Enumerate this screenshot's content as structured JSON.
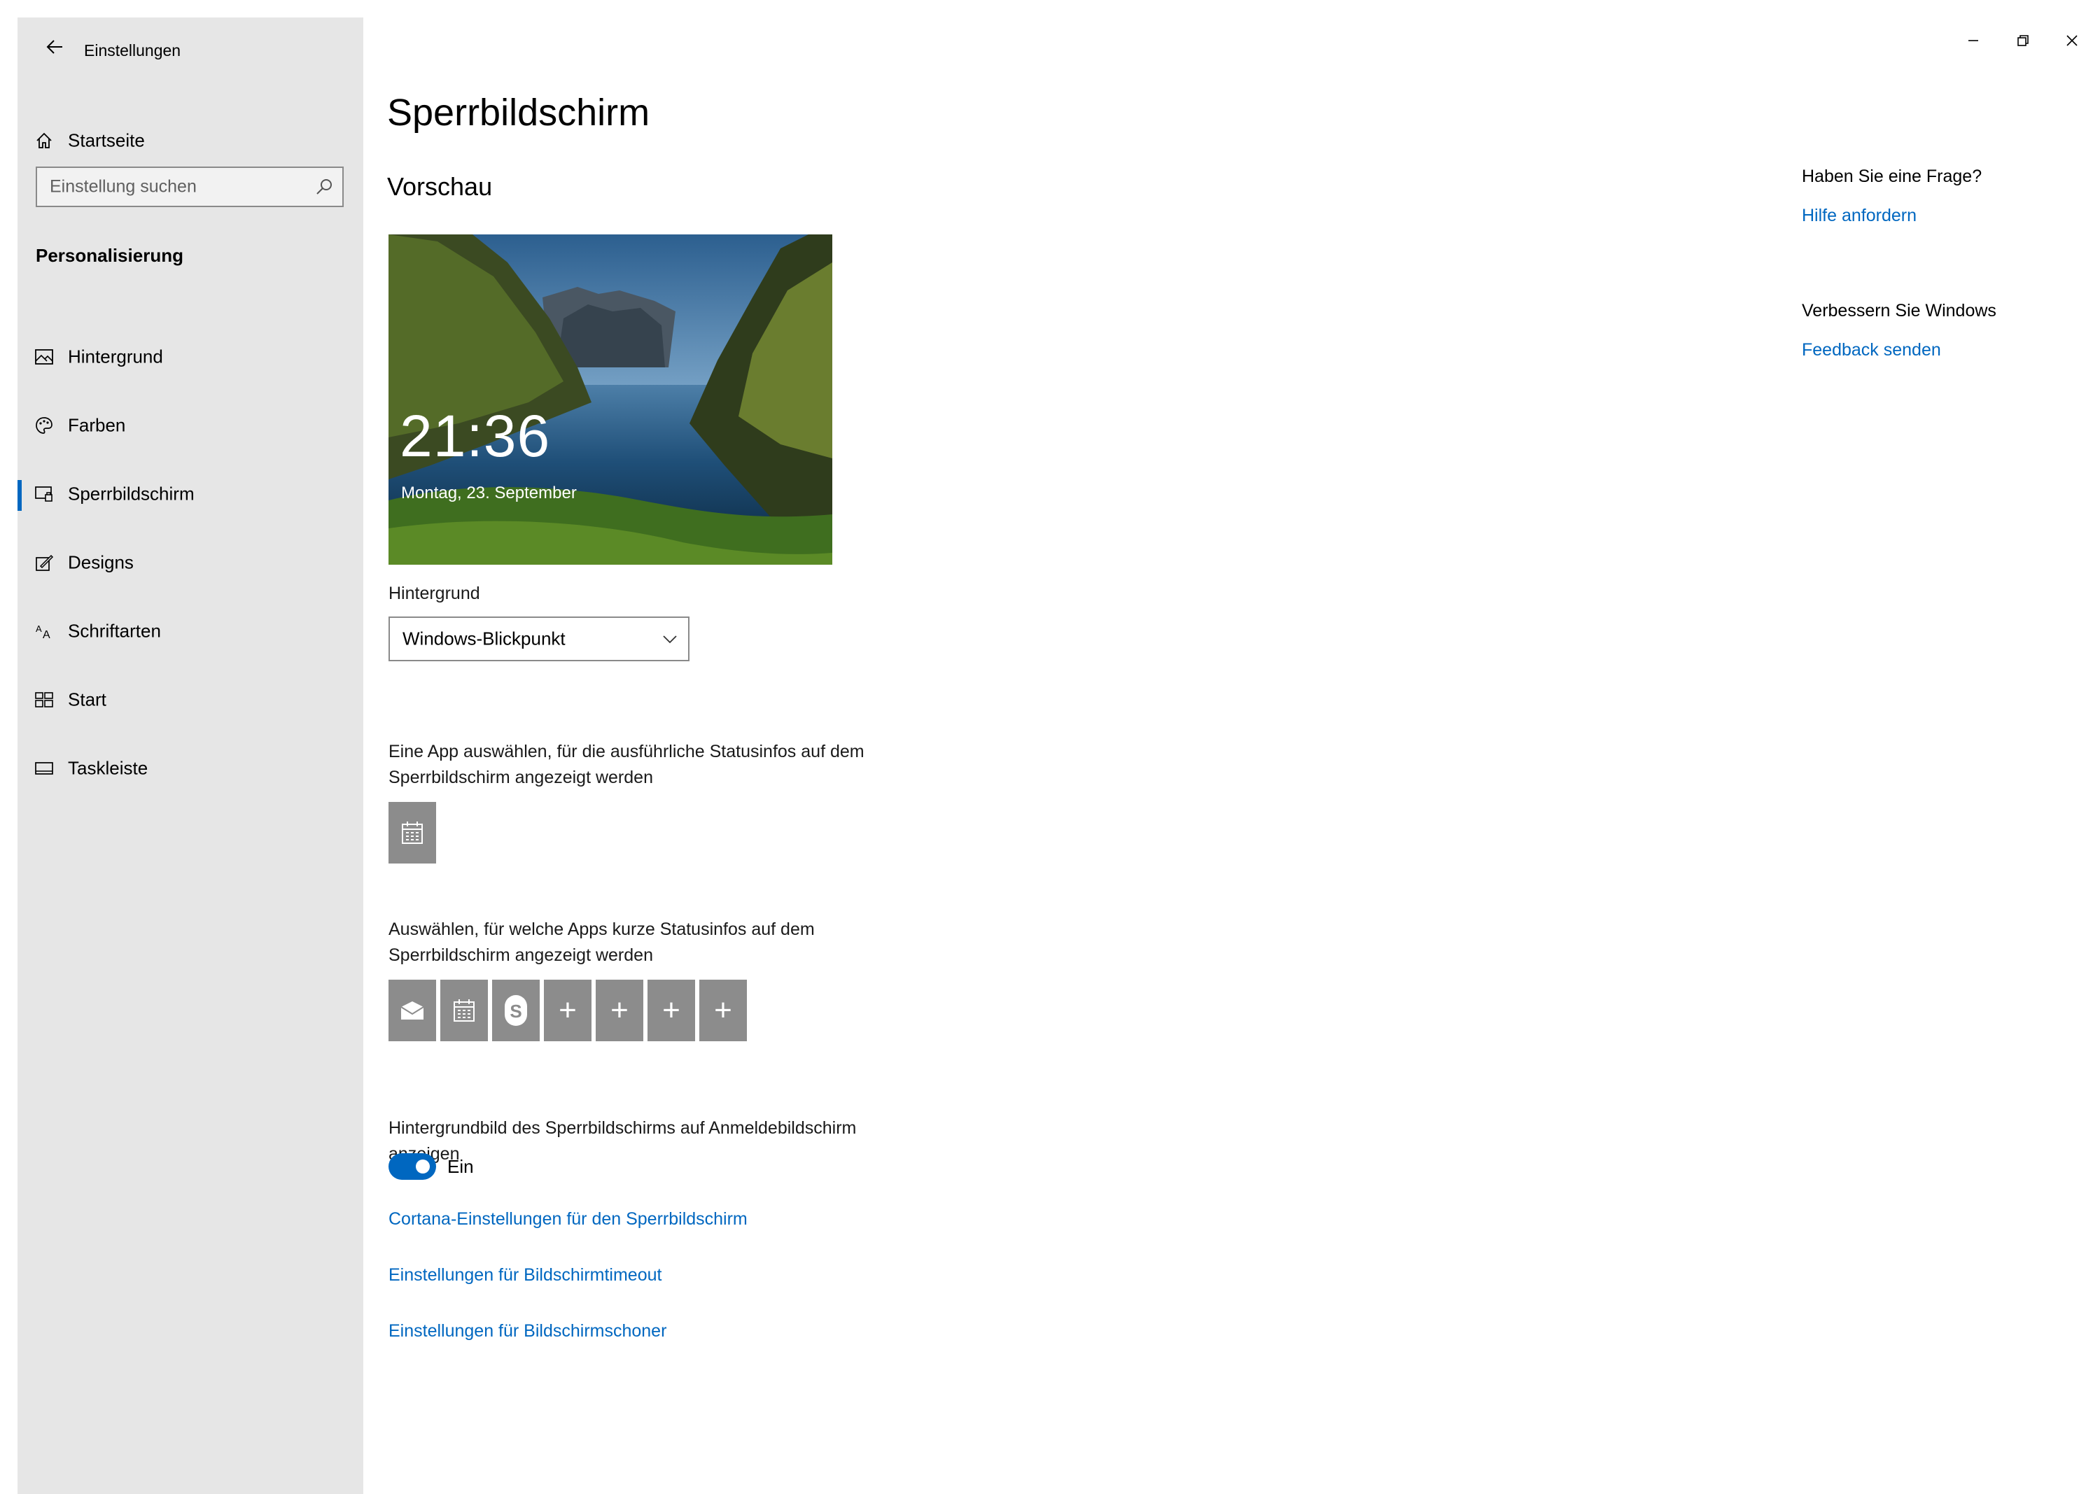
{
  "window": {
    "title": "Einstellungen",
    "controls": {
      "minimize": "minimize-icon",
      "restore": "restore-icon",
      "close": "close-icon"
    }
  },
  "sidebar": {
    "home_label": "Startseite",
    "search_placeholder": "Einstellung suchen",
    "section": "Personalisierung",
    "items": [
      {
        "label": "Hintergrund",
        "icon": "picture-icon"
      },
      {
        "label": "Farben",
        "icon": "palette-icon"
      },
      {
        "label": "Sperrbildschirm",
        "icon": "lockscreen-icon",
        "active": true
      },
      {
        "label": "Designs",
        "icon": "themes-icon"
      },
      {
        "label": "Schriftarten",
        "icon": "fonts-icon"
      },
      {
        "label": "Start",
        "icon": "start-icon"
      },
      {
        "label": "Taskleiste",
        "icon": "taskbar-icon"
      }
    ]
  },
  "main": {
    "title": "Sperrbildschirm",
    "preview_heading": "Vorschau",
    "preview": {
      "time": "21:36",
      "date": "Montag, 23. September"
    },
    "background_label": "Hintergrund",
    "background_value": "Windows-Blickpunkt",
    "detailed_app_text": "Eine App auswählen, für die ausführliche Statusinfos auf dem Sperrbildschirm angezeigt werden",
    "quick_apps_text": "Auswählen, für welche Apps kurze Statusinfos auf dem Sperrbildschirm angezeigt werden",
    "quick_apps": [
      "mail-icon",
      "calendar-icon",
      "skype-icon",
      "+",
      "+",
      "+",
      "+"
    ],
    "signin_bg_text": "Hintergrundbild des Sperrbildschirms auf Anmeldebildschirm anzeigen",
    "toggle_state": "Ein",
    "links": [
      "Cortana-Einstellungen für den Sperrbildschirm",
      "Einstellungen für Bildschirmtimeout",
      "Einstellungen für Bildschirmschoner"
    ]
  },
  "related": {
    "question": "Haben Sie eine Frage?",
    "help_link": "Hilfe anfordern",
    "improve": "Verbessern Sie Windows",
    "feedback_link": "Feedback senden"
  },
  "colors": {
    "accent": "#0067c0",
    "sidebar_bg": "#e6e6e6",
    "tile_bg": "#8c8c8c"
  }
}
